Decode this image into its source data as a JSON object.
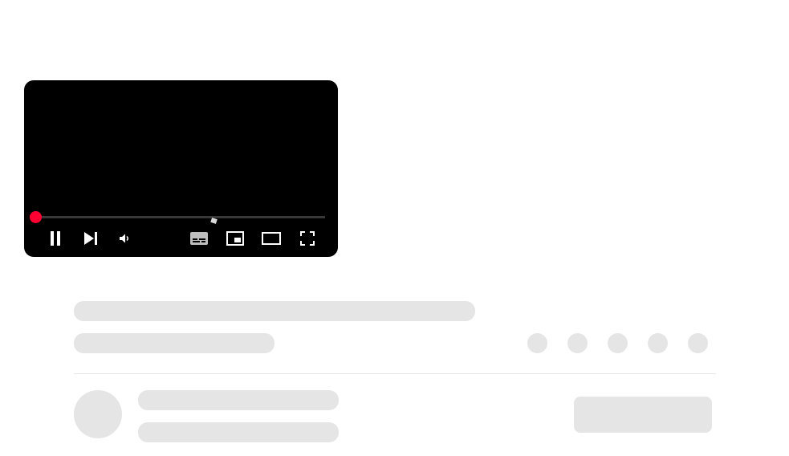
{
  "player": {
    "progress_fraction": 0,
    "accent_color": "#ff0033",
    "controls": [
      {
        "name": "pause-button",
        "icon": "pause-icon"
      },
      {
        "name": "next-button",
        "icon": "skip-next-icon"
      },
      {
        "name": "mute-button",
        "icon": "volume-icon"
      },
      {
        "name": "subtitles-button",
        "icon": "subtitles-icon"
      },
      {
        "name": "miniplayer-button",
        "icon": "miniplayer-icon"
      },
      {
        "name": "theater-mode-button",
        "icon": "theater-icon"
      },
      {
        "name": "fullscreen-button",
        "icon": "fullscreen-icon"
      }
    ]
  },
  "skeleton": {
    "placeholder_color": "#e5e5e5",
    "action_placeholders": 5
  }
}
